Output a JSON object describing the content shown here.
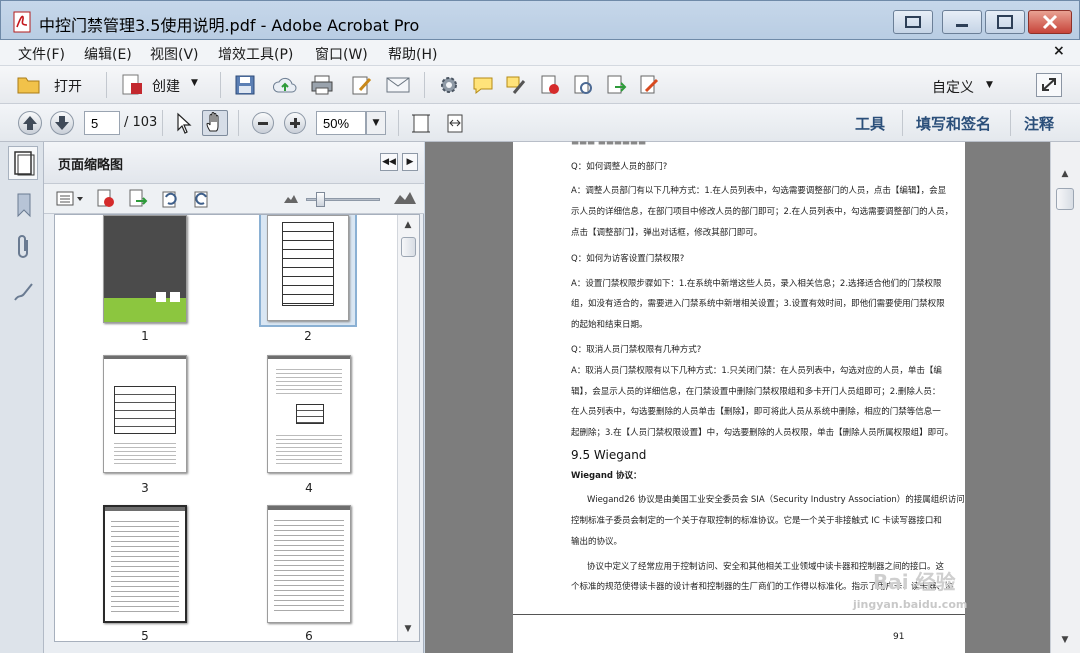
{
  "window": {
    "title": "中控门禁管理3.5使用说明.pdf - Adobe Acrobat Pro"
  },
  "menu": [
    "文件(F)",
    "编辑(E)",
    "视图(V)",
    "增效工具(P)",
    "窗口(W)",
    "帮助(H)"
  ],
  "toolbar": {
    "open_label": "打开",
    "create_label": "创建",
    "customize_label": "自定义"
  },
  "nav": {
    "page_current": "5",
    "page_total": "/ 103",
    "zoom": "50%"
  },
  "right_links": {
    "tools": "工具",
    "sign": "填写和签名",
    "comment": "注释"
  },
  "panel": {
    "title": "页面缩略图",
    "thumbnails": [
      "1",
      "2",
      "3",
      "4",
      "5",
      "6"
    ]
  },
  "document": {
    "q1": "Q：如何调整人员的部门?",
    "a1_1": "A：调整人员部门有以下几种方式：1.在人员列表中，勾选需要调整部门的人员，点击【编辑】，会显",
    "a1_2": "示人员的详细信息，在部门项目中修改人员的部门即可；2.在人员列表中，勾选需要调整部门的人员，",
    "a1_3": "点击【调整部门】，弹出对话框，修改其部门即可。",
    "q2": "Q：如何为访客设置门禁权限?",
    "a2_1": "A：设置门禁权限步骤如下：1.在系统中新增这些人员，录入相关信息；2.选择适合他们的门禁权限",
    "a2_2": "组，如没有适合的，需要进入门禁系统中新增相关设置；3.设置有效时间，即他们需要使用门禁权限",
    "a2_3": "的起始和结束日期。",
    "q3": "Q：取消人员门禁权限有几种方式?",
    "a3_1": "A：取消人员门禁权限有以下几种方式：1.只关闭门禁：在人员列表中，勾选对应的人员，单击【编",
    "a3_2": "辑】，会显示人员的详细信息，在门禁设置中删除门禁权限组和多卡开门人员组即可；2.删除人员：",
    "a3_3": "在人员列表中，勾选要删除的人员单击【删除】，即可将此人员从系统中删除，相应的门禁等信息一",
    "a3_4": "起删除；3.在【人员门禁权限设置】中，勾选要删除的人员权限，单击【删除人员所属权限组】即可。",
    "section": "9.5 Wiegand",
    "wiegand_label": "Wiegand 协议：",
    "w1": "Wiegand26 协议是由美国工业安全委员会 SIA（Security Industry Association）的接属组织访问",
    "w2": "控制标准子委员会制定的一个关于存取控制的标准协议。它是一个关于非接触式 IC 卡读写器接口和",
    "w3": "输出的协议。",
    "w4": "协议中定义了经常应用于控制访问、安全和其他相关工业领域中读卡器和控制器之间的接口。这",
    "w5": "个标准的规范使得读卡器的设计者和控制器的生厂商们的工作得以标准化。指示了用户卡、读卡器、协",
    "page_number": "91",
    "watermark": "Bai 经验",
    "watermark_url": "jingyan.baidu.com"
  }
}
